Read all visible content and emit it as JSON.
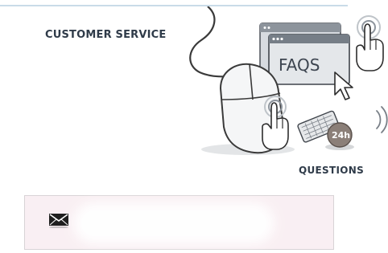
{
  "header": {
    "title": "CUSTOMER SERVICE"
  },
  "illustration": {
    "faq_label": "FAQS",
    "hours_badge": "24h",
    "caption": "QUESTIONS"
  },
  "contact": {
    "email_value": "",
    "icons": [
      "envelope-icon"
    ]
  },
  "colors": {
    "text": "#2f3b49",
    "rule": "#c9dbe8",
    "field_bg": "#f9eff3",
    "field_border": "#d8d3d6"
  }
}
